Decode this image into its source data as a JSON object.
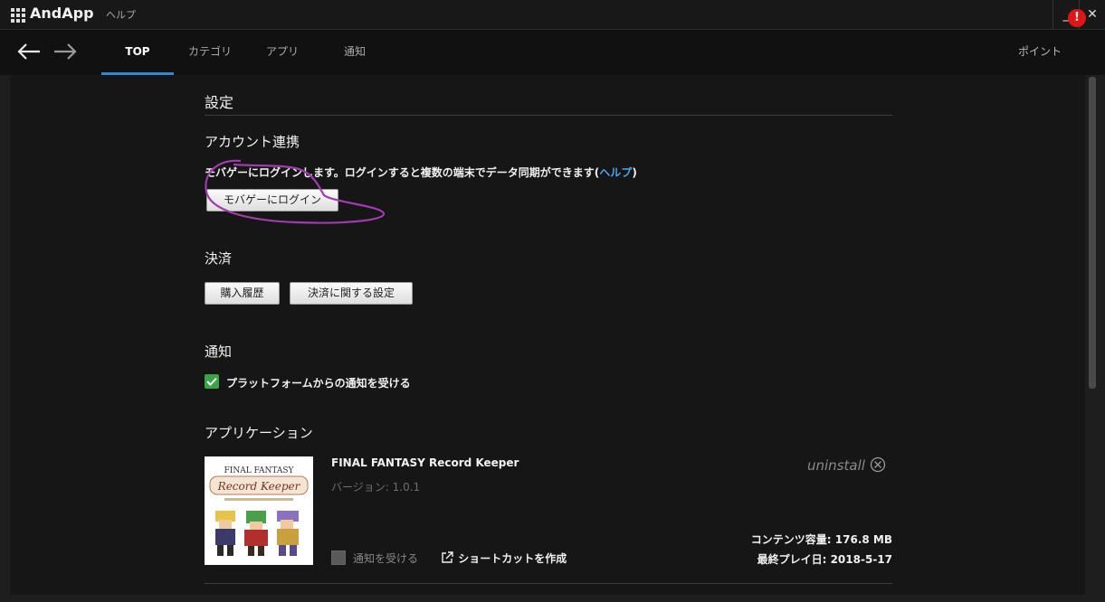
{
  "window": {
    "app_name": "AndApp",
    "help_menu": "ヘルプ",
    "minimize": "_",
    "close": "✕"
  },
  "nav": {
    "tabs": [
      {
        "label": "TOP",
        "active": true
      },
      {
        "label": "カテゴリ"
      },
      {
        "label": "アプリ"
      },
      {
        "label": "通知"
      }
    ],
    "points_label": "ポイント",
    "alert_badge": "!"
  },
  "settings": {
    "title": "設定",
    "account": {
      "heading": "アカウント連携",
      "description": "モバゲーにログインします。ログインすると複数の端末でデータ同期ができます(",
      "help_link": "ヘルプ",
      "closing_paren": ")",
      "login_button": "モバゲーにログイン"
    },
    "payment": {
      "heading": "決済",
      "history_button": "購入履歴",
      "settings_button": "決済に関する設定"
    },
    "notification": {
      "heading": "通知",
      "platform_checkbox_label": "プラットフォームからの通知を受ける",
      "checked": true
    },
    "applications": {
      "heading": "アプリケーション",
      "items": [
        {
          "title": "FINAL FANTASY Record Keeper",
          "version": "バージョン: 1.0.1",
          "uninstall": "uninstall",
          "notify_label": "通知を受ける",
          "notify_checked": false,
          "shortcut": "ショートカットを作成",
          "size": "コンテンツ容量: 176.8 MB",
          "last_played": "最終プレイ日: 2018-5-17",
          "logo_line1": "FINAL FANTASY",
          "logo_line2": "Record Keeper"
        }
      ]
    }
  },
  "colors": {
    "accent": "#2d8ad6",
    "link": "#4aa7e6",
    "checkbox": "#3aa34a",
    "alert": "#e01515",
    "annotation": "#a23bb0"
  }
}
